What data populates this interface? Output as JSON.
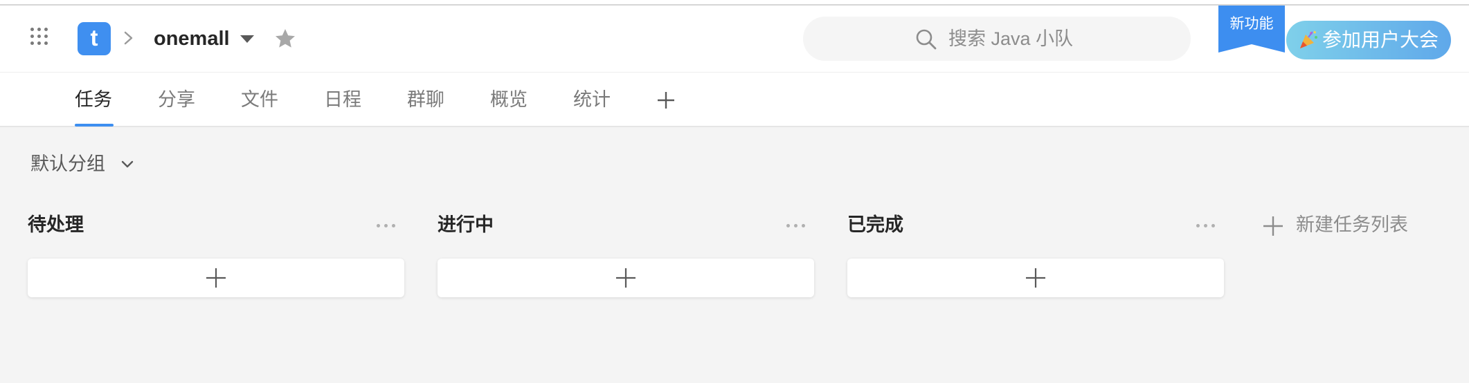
{
  "header": {
    "logo_letter": "t",
    "project_name": "onemall",
    "search_placeholder": "搜索 Java 小队",
    "new_feature_ribbon": "新功能",
    "conference_button": "参加用户大会"
  },
  "tabs": [
    {
      "label": "任务",
      "active": true
    },
    {
      "label": "分享"
    },
    {
      "label": "文件"
    },
    {
      "label": "日程"
    },
    {
      "label": "群聊"
    },
    {
      "label": "概览"
    },
    {
      "label": "统计"
    }
  ],
  "group_selector": {
    "label": "默认分组"
  },
  "columns": [
    {
      "title": "待处理"
    },
    {
      "title": "进行中"
    },
    {
      "title": "已完成"
    }
  ],
  "new_list_label": "新建任务列表",
  "colors": {
    "accent": "#3d8ef0",
    "logo_bg": "#3f8ff0",
    "ribbon_bg": "#3d8ef0",
    "conference_gradient_start": "#7fd0ea",
    "conference_gradient_end": "#5fa8ea",
    "page_bg": "#f4f4f4"
  },
  "icons": {
    "apps": "grid-dots-icon",
    "breadcrumb_separator": "chevron-right-icon",
    "project_menu": "caret-down-icon",
    "favorite": "star-icon",
    "search": "search-icon",
    "conference": "party-popper-icon",
    "tab_add": "plus-icon",
    "group_expand": "chevron-down-icon",
    "column_menu": "more-horizontal-icon",
    "add_task": "plus-icon",
    "new_list": "plus-icon"
  }
}
